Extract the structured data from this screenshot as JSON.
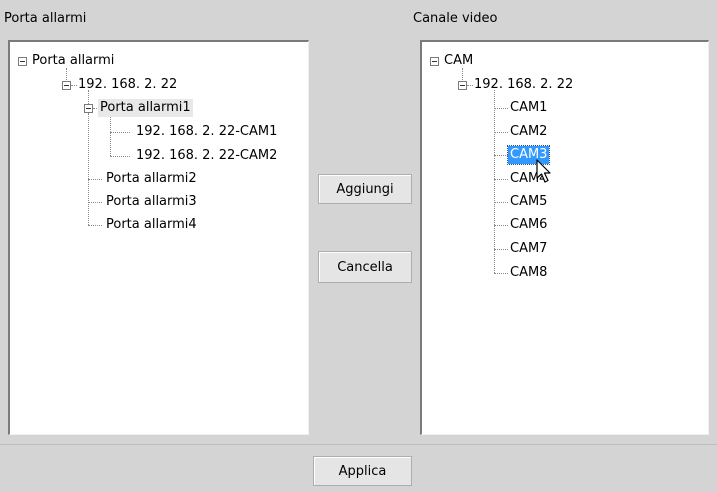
{
  "left_panel": {
    "title": "Porta allarmi",
    "tree": {
      "root": "Porta allarmi",
      "ip": "192. 168. 2. 22",
      "port1": "Porta allarmi1",
      "cam1": "192. 168. 2. 22-CAM1",
      "cam2": "192. 168. 2. 22-CAM2",
      "port2": "Porta allarmi2",
      "port3": "Porta allarmi3",
      "port4": "Porta allarmi4"
    }
  },
  "right_panel": {
    "title": "Canale video",
    "tree": {
      "root": "CAM",
      "ip": "192. 168. 2. 22",
      "cams": [
        "CAM1",
        "CAM2",
        "CAM3",
        "CAM4",
        "CAM5",
        "CAM6",
        "CAM7",
        "CAM8"
      ],
      "selected": "CAM3"
    }
  },
  "buttons": {
    "add": "Aggiungi",
    "cancel": "Cancella",
    "apply": "Applica"
  },
  "icons": {
    "expander": "tree-expander-icon",
    "cursor": "mouse-cursor-icon"
  }
}
